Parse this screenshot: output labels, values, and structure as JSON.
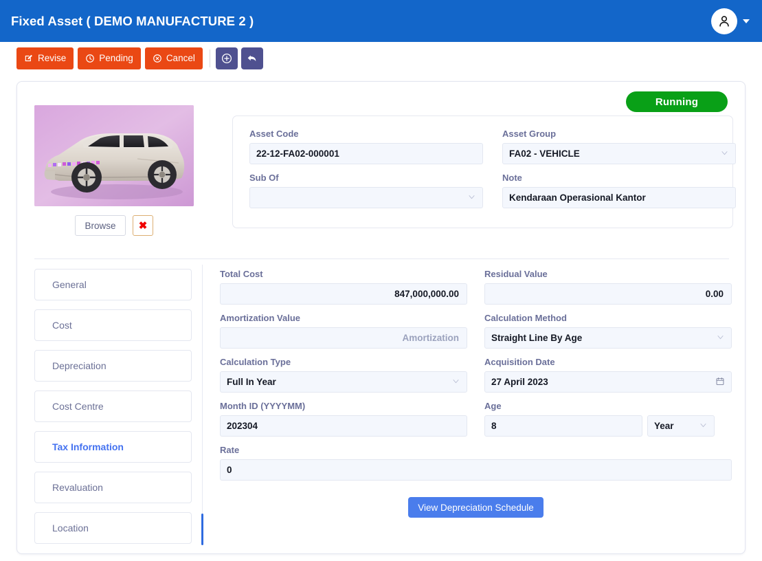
{
  "header": {
    "title": "Fixed Asset ( DEMO MANUFACTURE 2 )",
    "avatar_icon": "user-icon",
    "caret_icon": "chevron-down-icon",
    "bg_color": "#1366c9"
  },
  "toolbar": {
    "buttons": [
      {
        "label": "Revise",
        "icon": "edit-square-icon",
        "color": "#ea4814"
      },
      {
        "label": "Pending",
        "icon": "clock-icon",
        "color": "#ea4814"
      },
      {
        "label": "Cancel",
        "icon": "circle-x-icon",
        "color": "#ea4814"
      }
    ],
    "icon_buttons": [
      {
        "name": "add-button",
        "icon": "plus-circle-icon",
        "color": "#4f5190"
      },
      {
        "name": "back-button",
        "icon": "undo-arrow-icon",
        "color": "#4f5190"
      }
    ]
  },
  "status": {
    "label": "Running",
    "color": "#09a017"
  },
  "photo": {
    "alt": "asset-photo-vehicle",
    "browse_label": "Browse",
    "remove_label": "✖"
  },
  "info_panel": {
    "asset_code": {
      "label": "Asset Code",
      "value": "22-12-FA02-000001"
    },
    "asset_group": {
      "label": "Asset Group",
      "value": "FA02 - VEHICLE",
      "icon": "chevron-down-icon"
    },
    "sub_of": {
      "label": "Sub Of",
      "value": "",
      "icon": "chevron-down-icon"
    },
    "note": {
      "label": "Note",
      "value": "Kendaraan Operasional Kantor"
    }
  },
  "tabs": [
    {
      "label": "General",
      "active": false
    },
    {
      "label": "Cost",
      "active": false
    },
    {
      "label": "Depreciation",
      "active": false
    },
    {
      "label": "Cost Centre",
      "active": false
    },
    {
      "label": "Tax Information",
      "active": true
    },
    {
      "label": "Revaluation",
      "active": false
    },
    {
      "label": "Location",
      "active": false
    }
  ],
  "form": {
    "total_cost": {
      "label": "Total Cost",
      "value": "847,000,000.00"
    },
    "residual_value": {
      "label": "Residual Value",
      "value": "0.00"
    },
    "amortization_value": {
      "label": "Amortization Value",
      "value": "",
      "placeholder": "Amortization"
    },
    "calculation_method": {
      "label": "Calculation Method",
      "value": "Straight Line By Age",
      "icon": "chevron-down-icon"
    },
    "calculation_type": {
      "label": "Calculation Type",
      "value": "Full In Year",
      "icon": "chevron-down-icon"
    },
    "acquisition_date": {
      "label": "Acquisition Date",
      "value": "27 April 2023",
      "icon": "calendar-icon"
    },
    "month_id": {
      "label": "Month ID (YYYYMM)",
      "value": "202304"
    },
    "age": {
      "label": "Age",
      "value": "8"
    },
    "age_unit": {
      "value": "Year",
      "icon": "chevron-down-icon"
    },
    "rate": {
      "label": "Rate",
      "value": "0"
    },
    "submit_label": "View Depreciation Schedule"
  }
}
